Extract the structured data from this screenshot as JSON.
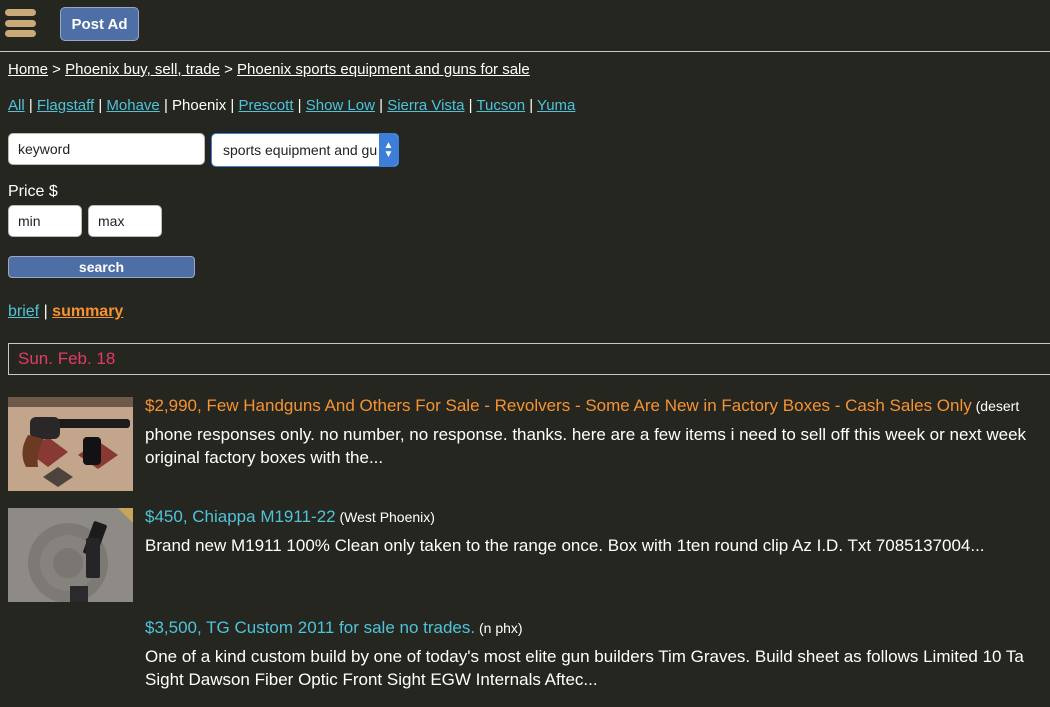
{
  "header": {
    "menu_icon": "hamburger-menu-icon",
    "post_ad_label": "Post Ad"
  },
  "breadcrumb": {
    "home": "Home",
    "sep1": " > ",
    "region": "Phoenix buy, sell, trade",
    "sep2": " > ",
    "category": "Phoenix sports equipment and guns for sale"
  },
  "cities": {
    "all": "All",
    "flagstaff": "Flagstaff",
    "mohave": "Mohave",
    "phoenix": "Phoenix",
    "prescott": "Prescott",
    "show_low": "Show Low",
    "sierra_vista": "Sierra Vista",
    "tucson": "Tucson",
    "yuma": "Yuma",
    "separator": " | "
  },
  "search": {
    "keyword_placeholder": "keyword",
    "category_selected": "sports equipment and guns",
    "price_label": "Price $",
    "min_placeholder": "min",
    "max_placeholder": "max",
    "button_label": "search"
  },
  "view": {
    "brief": "brief",
    "separator": " | ",
    "summary": "summary"
  },
  "date_header": "Sun. Feb. 18",
  "colors": {
    "background": "#262620",
    "link_cyan": "#4fc3d9",
    "highlight_orange": "#f59331",
    "date_pink": "#e23b63",
    "button_blue": "#4e6fa5"
  },
  "listings": [
    {
      "title": "$2,990, Few Handguns And Others For Sale - Revolvers - Some Are New in Factory Boxes - Cash Sales Only",
      "location": " (desert",
      "description_line1": "phone responses only. no number, no response. thanks. here are a few items i need to sell off this week or next week",
      "description_line2": "original factory boxes with the...",
      "title_color": "#f59331"
    },
    {
      "title": "$450, Chiappa M1911-22",
      "location": " (West Phoenix)",
      "description_line1": "Brand new M1911 100% Clean only taken to the range once. Box with 1ten round clip Az I.D. Txt 7085137004...",
      "description_line2": "",
      "title_color": "#4fc3d9"
    },
    {
      "title": "$3,500, TG Custom 2011 for sale no trades.",
      "location": " (n phx)",
      "description_line1": "One of a kind custom build by one of today's most elite gun builders Tim Graves. Build sheet as follows Limited 10 Ta",
      "description_line2": "Sight Dawson Fiber Optic Front Sight EGW Internals Aftec...",
      "title_color": "#4fc3d9"
    }
  ]
}
